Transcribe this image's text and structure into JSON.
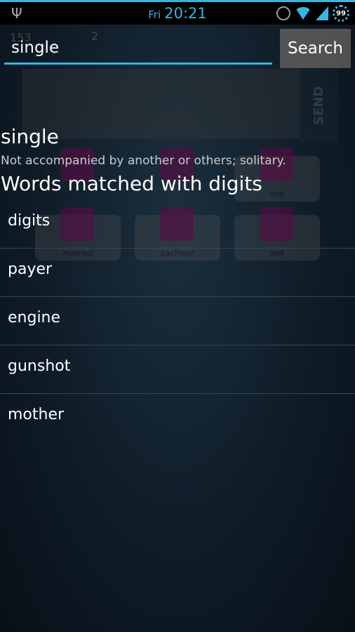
{
  "status_bar": {
    "day": "Fri",
    "time": "20:21",
    "battery": "99",
    "icons": [
      "usb-icon",
      "alarm-icon",
      "wifi-icon",
      "signal-icon",
      "battery-icon"
    ]
  },
  "background_game": {
    "coins": "153",
    "keys": "2",
    "send_label": "SEND",
    "tiles": [
      "one",
      "married",
      "bachelor",
      "self"
    ]
  },
  "search": {
    "value": "single",
    "button_label": "Search"
  },
  "result": {
    "word": "single",
    "definition": "Not accompanied by another or others; solitary.",
    "matches_heading": "Words matched with digits",
    "matches": [
      "digits",
      "payer",
      "engine",
      "gunshot",
      "mother"
    ]
  },
  "colors": {
    "accent": "#33b5e5"
  }
}
